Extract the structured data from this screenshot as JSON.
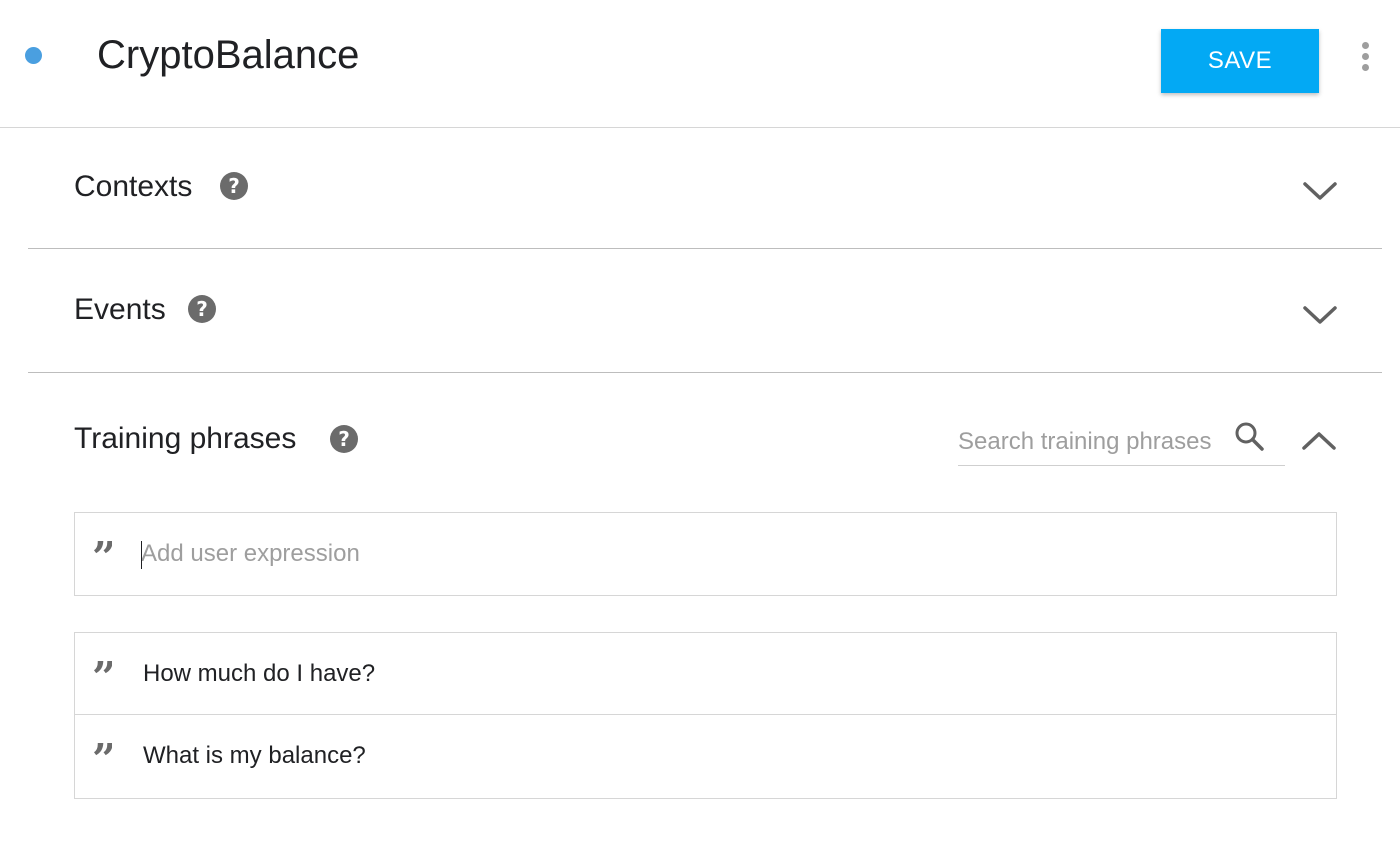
{
  "header": {
    "title": "CryptoBalance",
    "save_label": "SAVE",
    "status_color": "#4a9fe0",
    "accent_color": "#03a9f4"
  },
  "sections": {
    "contexts": {
      "label": "Contexts",
      "help_icon": "?",
      "expanded": false
    },
    "events": {
      "label": "Events",
      "help_icon": "?",
      "expanded": false
    },
    "training": {
      "label": "Training phrases",
      "help_icon": "?",
      "expanded": true,
      "search_placeholder": "Search training phrases",
      "search_value": "",
      "new_expression_placeholder": "Add user expression",
      "new_expression_value": "",
      "quote_glyph": "”",
      "phrases": [
        {
          "text": "How much do I have?"
        },
        {
          "text": "What is my balance?"
        }
      ]
    }
  }
}
